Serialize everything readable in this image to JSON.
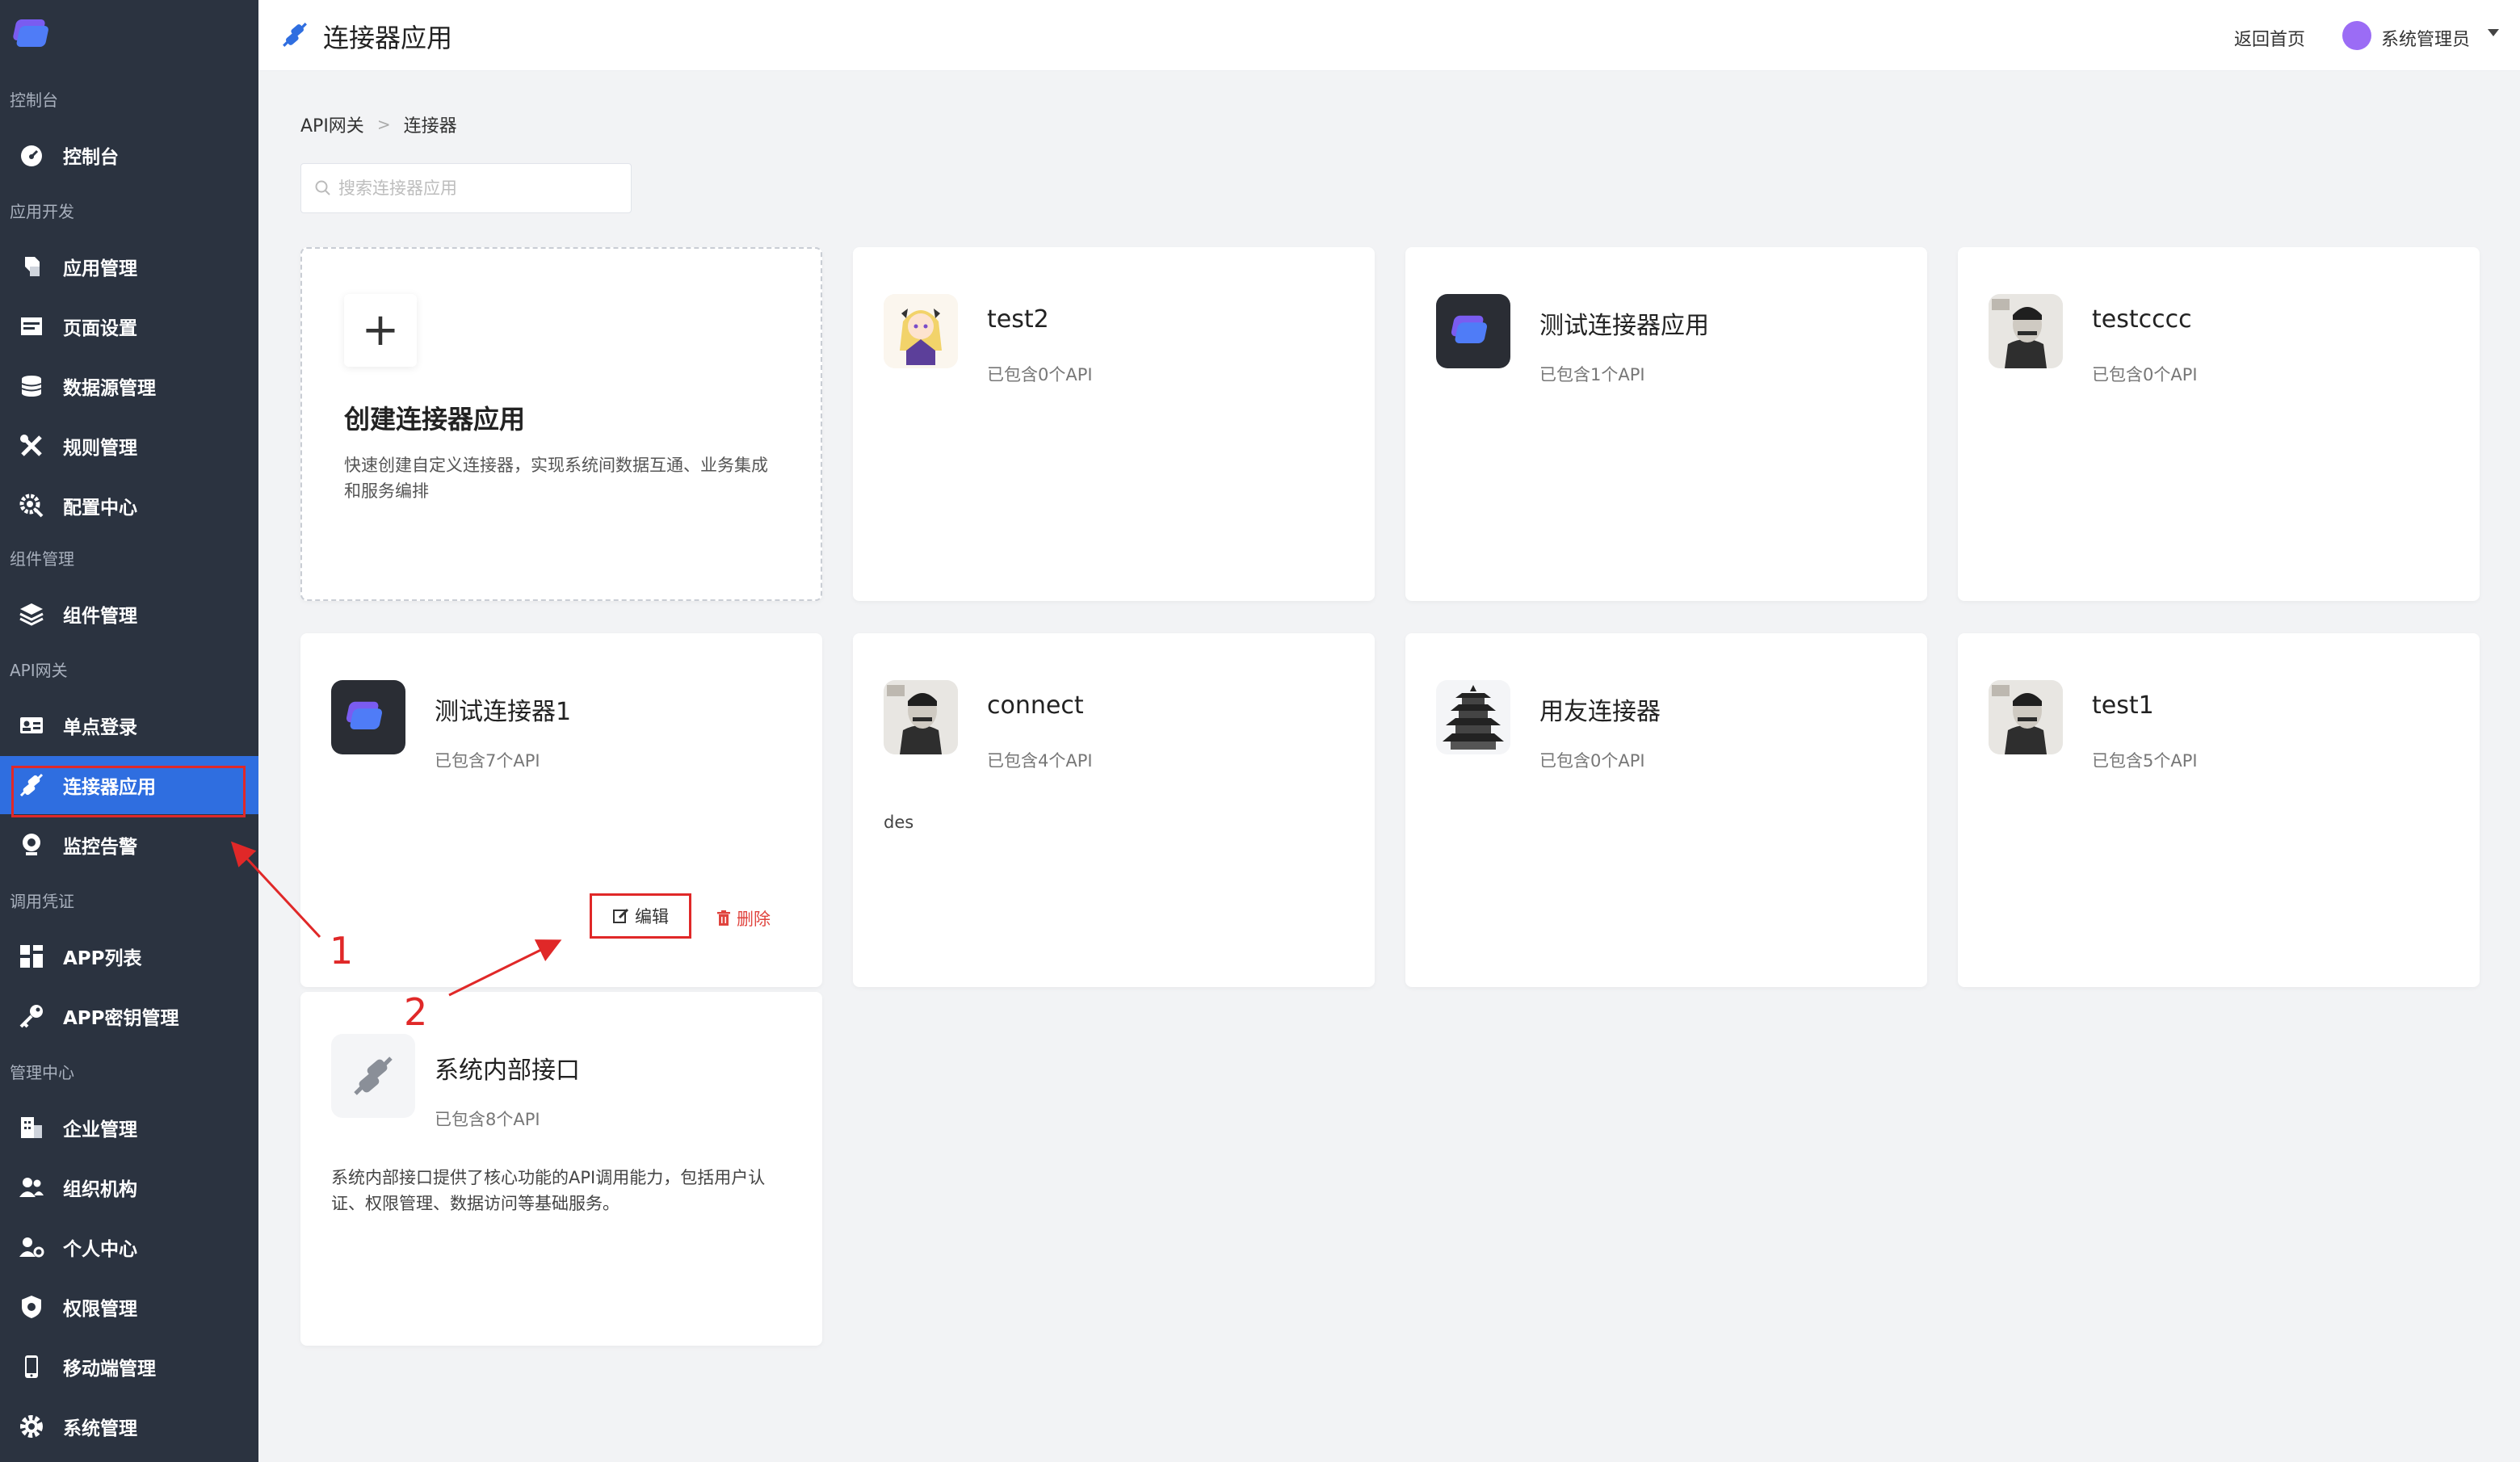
{
  "header": {
    "title": "连接器应用",
    "home_link": "返回首页",
    "user_name": "系统管理员"
  },
  "sidebar": {
    "groups": [
      {
        "label": "控制台"
      },
      {
        "label": "应用开发"
      },
      {
        "label": "组件管理"
      },
      {
        "label": "API网关"
      },
      {
        "label": "调用凭证"
      },
      {
        "label": "管理中心"
      }
    ],
    "items": [
      {
        "label": "控制台",
        "icon": "dashboard-icon"
      },
      {
        "label": "应用管理",
        "icon": "cubes-icon"
      },
      {
        "label": "页面设置",
        "icon": "page-icon"
      },
      {
        "label": "数据源管理",
        "icon": "database-icon"
      },
      {
        "label": "规则管理",
        "icon": "tools-icon"
      },
      {
        "label": "配置中心",
        "icon": "gear-search-icon"
      },
      {
        "label": "组件管理",
        "icon": "layers-icon"
      },
      {
        "label": "单点登录",
        "icon": "id-card-icon"
      },
      {
        "label": "连接器应用",
        "icon": "plug-icon",
        "active": true
      },
      {
        "label": "监控告警",
        "icon": "webcam-icon"
      },
      {
        "label": "APP列表",
        "icon": "grid-icon"
      },
      {
        "label": "APP密钥管理",
        "icon": "key-icon"
      },
      {
        "label": "企业管理",
        "icon": "building-icon"
      },
      {
        "label": "组织机构",
        "icon": "users-icon"
      },
      {
        "label": "个人中心",
        "icon": "user-cog-icon"
      },
      {
        "label": "权限管理",
        "icon": "shield-icon"
      },
      {
        "label": "移动端管理",
        "icon": "mobile-icon"
      },
      {
        "label": "系统管理",
        "icon": "gear-icon"
      }
    ]
  },
  "breadcrumb": {
    "root": "API网关",
    "current": "连接器"
  },
  "search": {
    "placeholder": "搜索连接器应用"
  },
  "create_card": {
    "title": "创建连接器应用",
    "description": "快速创建自定义连接器，实现系统间数据互通、业务集成和服务编排"
  },
  "cards": [
    {
      "title": "test2",
      "subtitle": "已包含0个API",
      "description": ""
    },
    {
      "title": "测试连接器应用",
      "subtitle": "已包含1个API",
      "description": ""
    },
    {
      "title": "testcccc",
      "subtitle": "已包含0个API",
      "description": ""
    },
    {
      "title": "测试连接器1",
      "subtitle": "已包含7个API",
      "description": "",
      "edit_label": "编辑",
      "delete_label": "删除"
    },
    {
      "title": "connect",
      "subtitle": "已包含4个API",
      "description": "des"
    },
    {
      "title": "用友连接器",
      "subtitle": "已包含0个API",
      "description": ""
    },
    {
      "title": "test1",
      "subtitle": "已包含5个API",
      "description": ""
    },
    {
      "title": "系统内部接口",
      "subtitle": "已包含8个API",
      "description": "系统内部接口提供了核心功能的API调用能力，包括用户认证、权限管理、数据访问等基础服务。"
    }
  ],
  "annotations": {
    "step1": "1",
    "step2": "2"
  },
  "colors": {
    "sidebar_bg": "#2b3340",
    "active_item": "#2f6ee0",
    "annotation_red": "#e02828",
    "delete_red": "#e0443e"
  }
}
